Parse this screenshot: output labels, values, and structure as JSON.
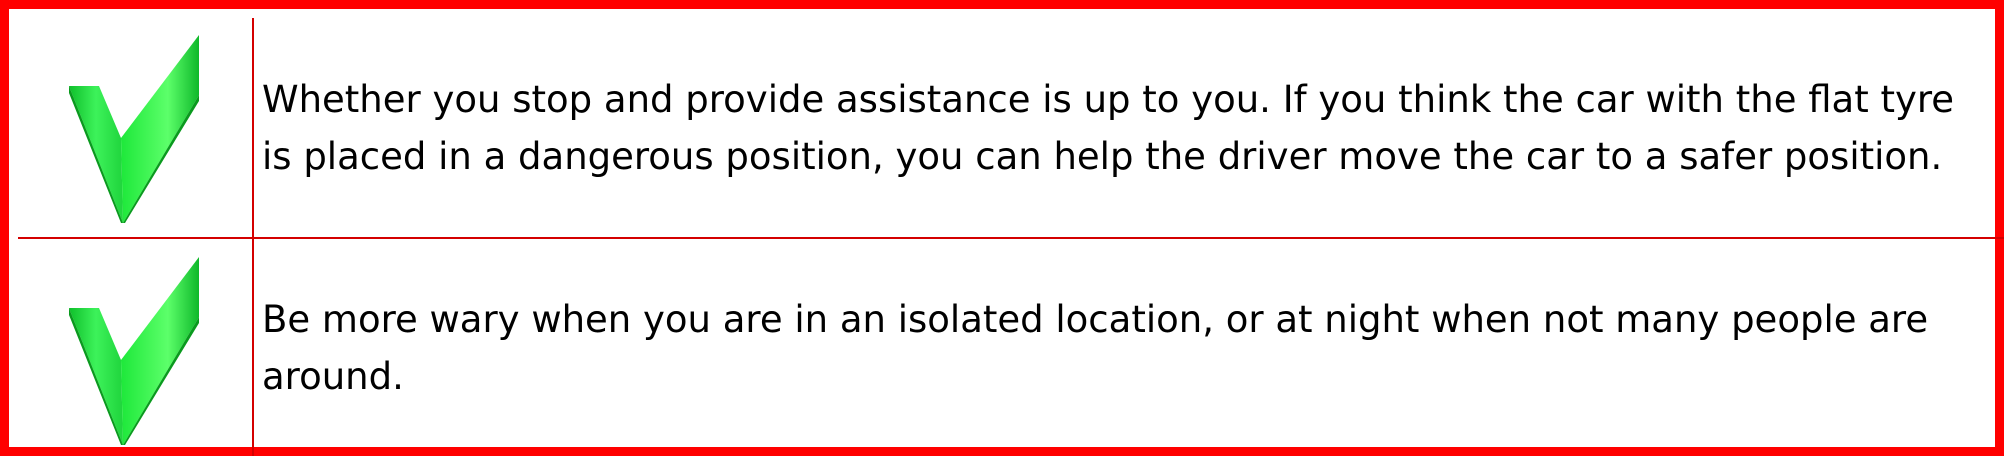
{
  "items": [
    {
      "icon": "checkmark-icon",
      "text": "Whether you stop and provide assistance is up to you. If you think the car with the flat tyre is placed in a dangerous position, you can help the driver move the car to a safer position."
    },
    {
      "icon": "checkmark-icon",
      "text": "Be more wary when you are in an isolated location, or at night when not many people are around."
    }
  ],
  "colors": {
    "border": "#ff0000",
    "divider": "#d40000",
    "check_light": "#5cff6a",
    "check_mid": "#1ee83a",
    "check_dark": "#0a9a1e",
    "text": "#000000",
    "background": "#ffffff"
  }
}
